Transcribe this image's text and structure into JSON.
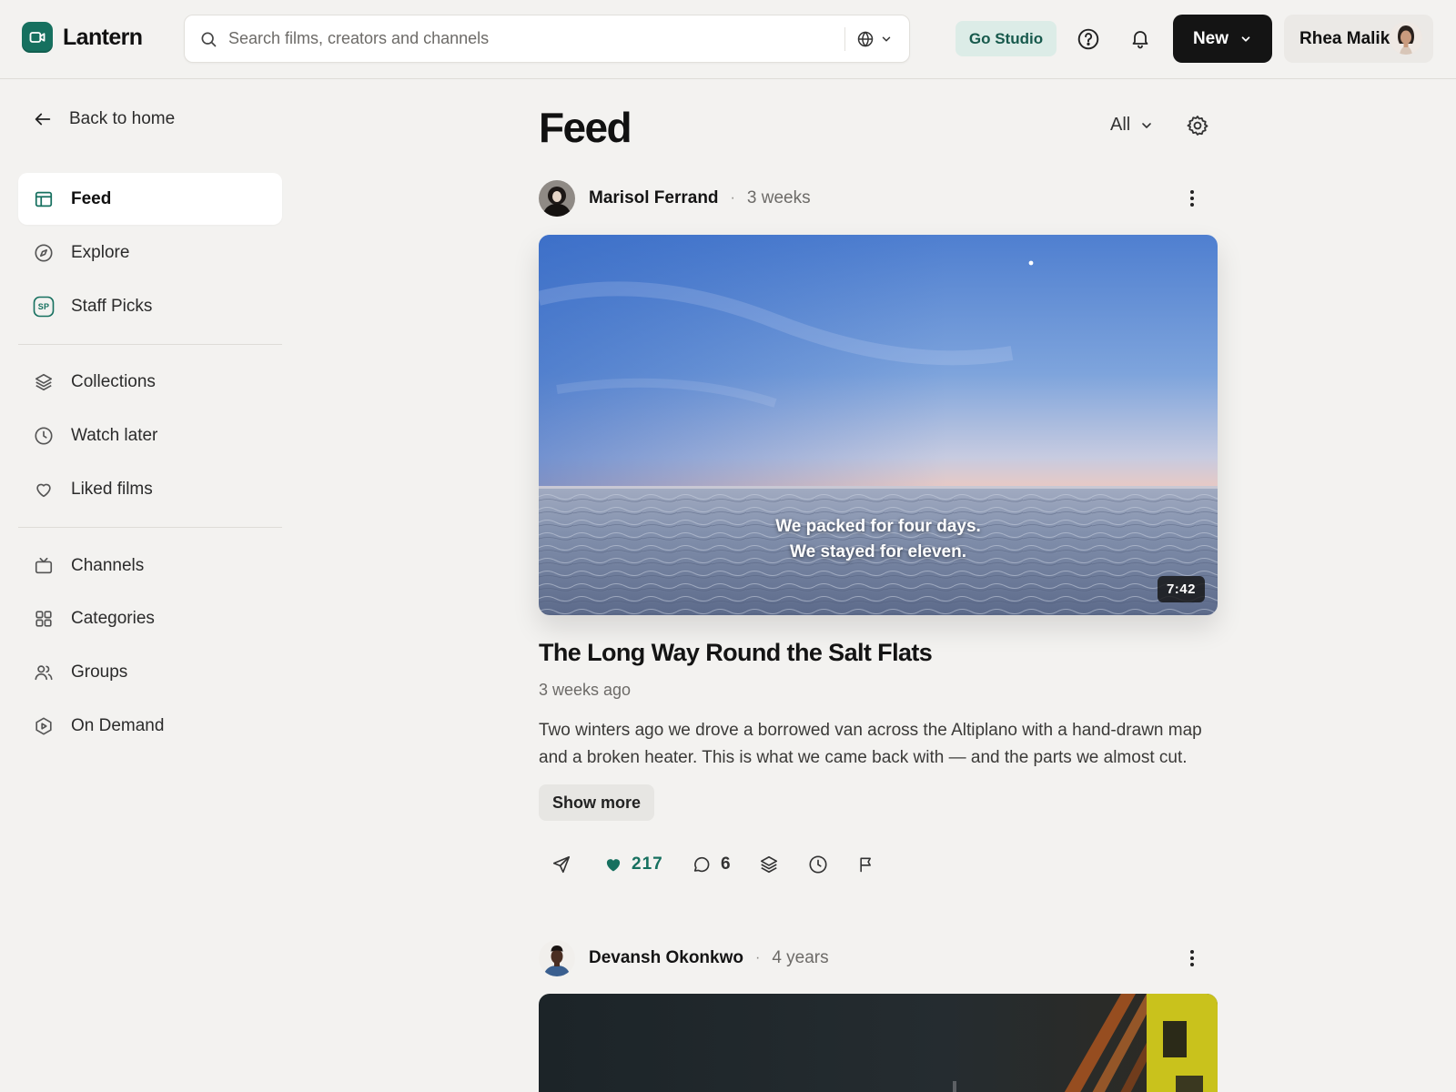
{
  "app": {
    "name": "Lantern",
    "brand_color": "#16705f"
  },
  "search": {
    "placeholder": "Search films, creators and channels",
    "icon": "search-icon",
    "language_icon": "globe-icon"
  },
  "header": {
    "go_studio_label": "Go Studio",
    "help_icon": "help-circle-icon",
    "notifications_icon": "bell-icon",
    "new_label": "New",
    "user_name": "Rhea Malik"
  },
  "sidebar": {
    "back_label": "Back to home",
    "groups": [
      [
        {
          "label": "Feed",
          "icon": "feed-icon",
          "active": true
        },
        {
          "label": "Explore",
          "icon": "compass-icon"
        },
        {
          "label": "Staff Picks",
          "icon": "staff-picks-icon",
          "badge": "SP"
        }
      ],
      [
        {
          "label": "Collections",
          "icon": "layers-icon"
        },
        {
          "label": "Watch later",
          "icon": "clock-icon"
        },
        {
          "label": "Liked films",
          "icon": "heart-icon"
        }
      ],
      [
        {
          "label": "Channels",
          "icon": "tv-icon"
        },
        {
          "label": "Categories",
          "icon": "grid-icon"
        },
        {
          "label": "Groups",
          "icon": "users-icon"
        },
        {
          "label": "On Demand",
          "icon": "play-badge-icon"
        }
      ]
    ]
  },
  "feed": {
    "title": "Feed",
    "filter_value": "All",
    "posts": [
      {
        "author": "Marisol Ferrand",
        "age": "3 weeks",
        "caption_line1": "We packed for four days.",
        "caption_line2": "We stayed for eleven.",
        "duration": "7:42",
        "title": "The Long Way Round the Salt Flats",
        "date": "3 weeks ago",
        "description": "Two winters ago we drove a borrowed van across the Altiplano with a hand-drawn map and a broken heater. This is what we came back with — and the parts we almost cut.",
        "show_more_label": "Show more",
        "likes": "217",
        "comments": "6"
      },
      {
        "author": "Devansh Okonkwo",
        "age": "4 years"
      }
    ]
  }
}
